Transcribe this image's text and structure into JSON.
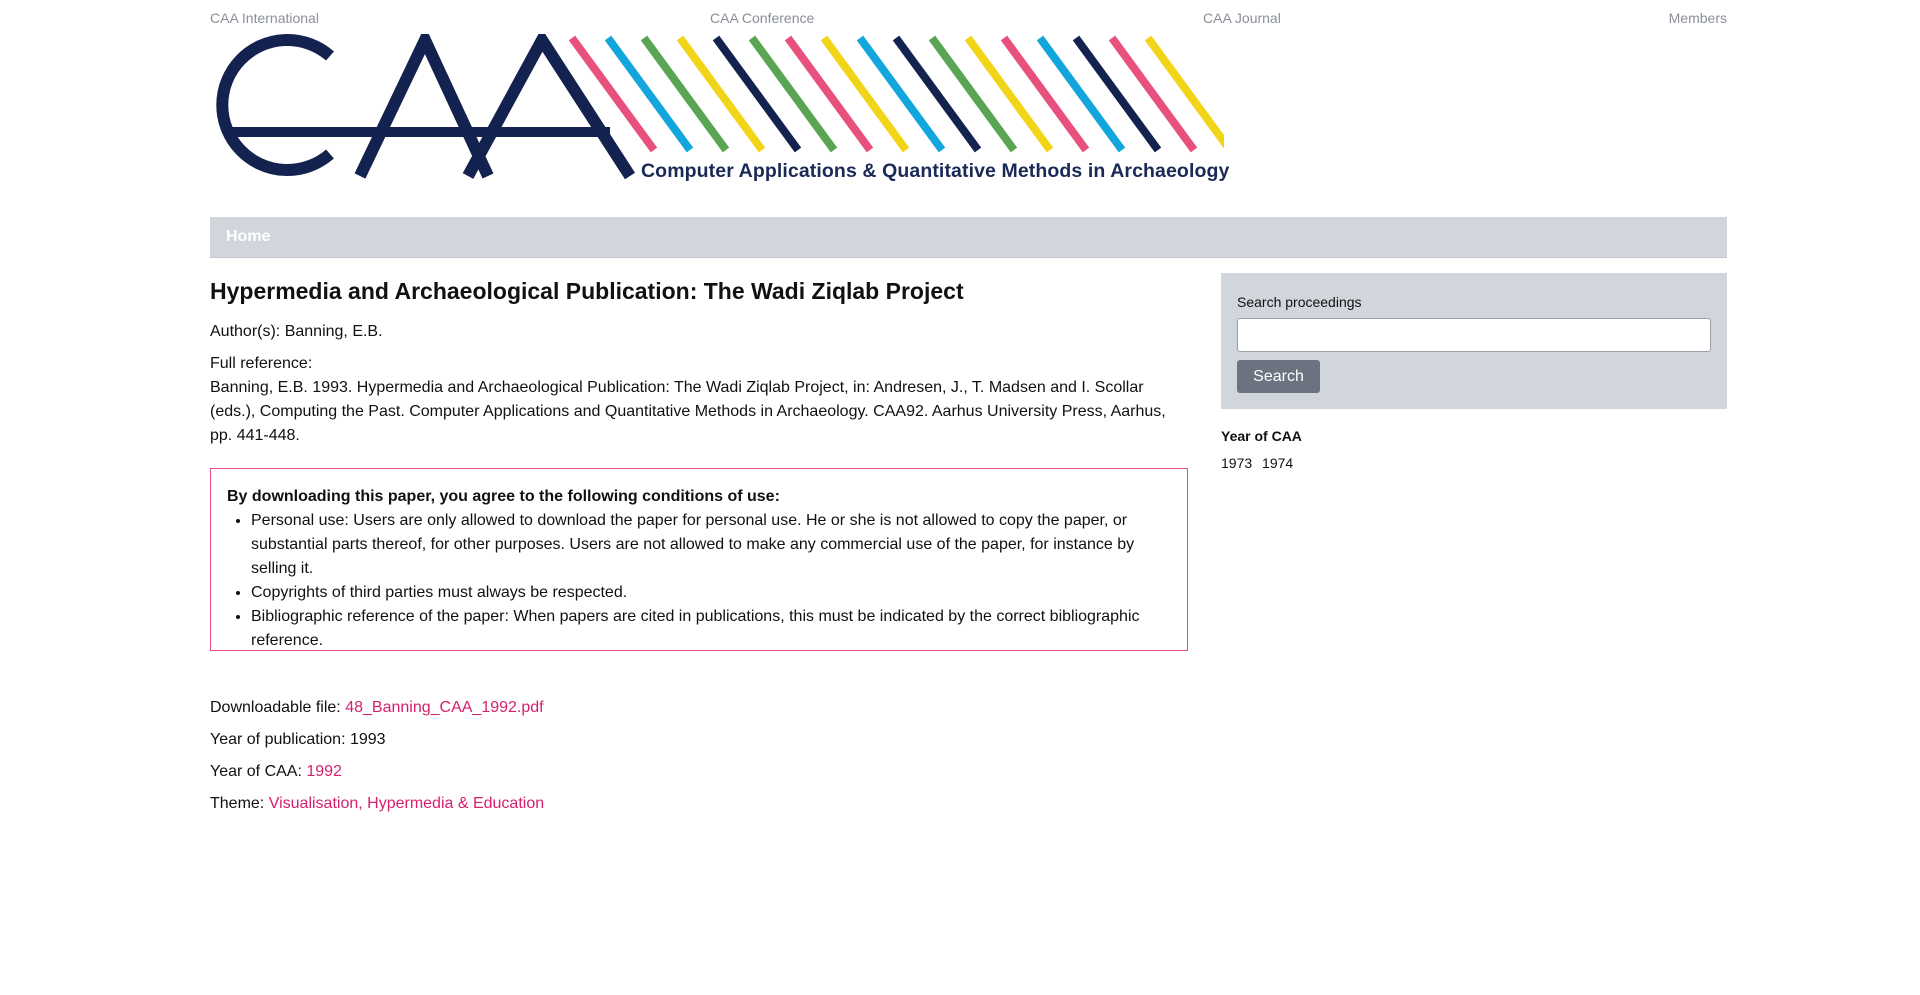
{
  "top_nav": {
    "links": [
      "CAA International",
      "CAA Conference",
      "CAA Journal",
      "Members"
    ]
  },
  "logo": {
    "letters": "CAA",
    "tagline": "Computer Applications & Quantitative Methods in Archaeology",
    "navy": "#13224f",
    "stripe_colors": [
      "#e8507e",
      "#12a6dd",
      "#5aa553",
      "#f2d418",
      "#13224f",
      "#5aa553",
      "#e8507e",
      "#f2d418",
      "#12a6dd",
      "#13224f",
      "#5aa553",
      "#f2d418",
      "#e8507e",
      "#12a6dd",
      "#13224f",
      "#e8507e",
      "#f2d418"
    ]
  },
  "navbar": {
    "home_label": "Home"
  },
  "article": {
    "title": "Hypermedia and Archaeological Publication: The Wadi Ziqlab Project",
    "authors_label": "Author(s):",
    "authors": "Banning, E.B.",
    "full_reference_label": "Full reference:",
    "full_reference": "Banning, E.B. 1993. Hypermedia and Archaeological Publication: The Wadi Ziqlab Project, in: Andresen, J., T. Madsen and I. Scollar (eds.), Computing the Past. Computer Applications and Quantitative Methods in Archaeology. CAA92. Aarhus University Press, Aarhus, pp. 441-448.",
    "conditions_heading": "By downloading this paper, you agree to the following conditions of use:",
    "conditions": [
      "Personal use: Users are only allowed to download the paper for personal use. He or she is not allowed to copy the paper, or substantial parts thereof, for other purposes. Users are not allowed to make any commercial use of the paper, for instance by selling it.",
      "Copyrights of third parties must always be respected.",
      "Bibliographic reference of the paper: When papers are cited in publications, this must be indicated by the correct bibliographic reference."
    ],
    "file_label": "Downloadable file:",
    "file_name": "48_Banning_CAA_1992.pdf",
    "pub_year_label": "Year of publication:",
    "pub_year": "1993",
    "caa_year_label": "Year of CAA:",
    "caa_year": "1992",
    "theme_label": "Theme:",
    "theme": "Visualisation, Hypermedia & Education"
  },
  "sidebar": {
    "search_label": "Search proceedings",
    "search_value": "",
    "search_button": "Search",
    "year_title": "Year of CAA",
    "years": [
      "1973",
      "1974"
    ]
  },
  "colors": {
    "accent_pink": "#d4206f",
    "nav_gray": "#d1d5dc",
    "button_gray": "#6b7280",
    "border_pink": "#e24b8c"
  }
}
